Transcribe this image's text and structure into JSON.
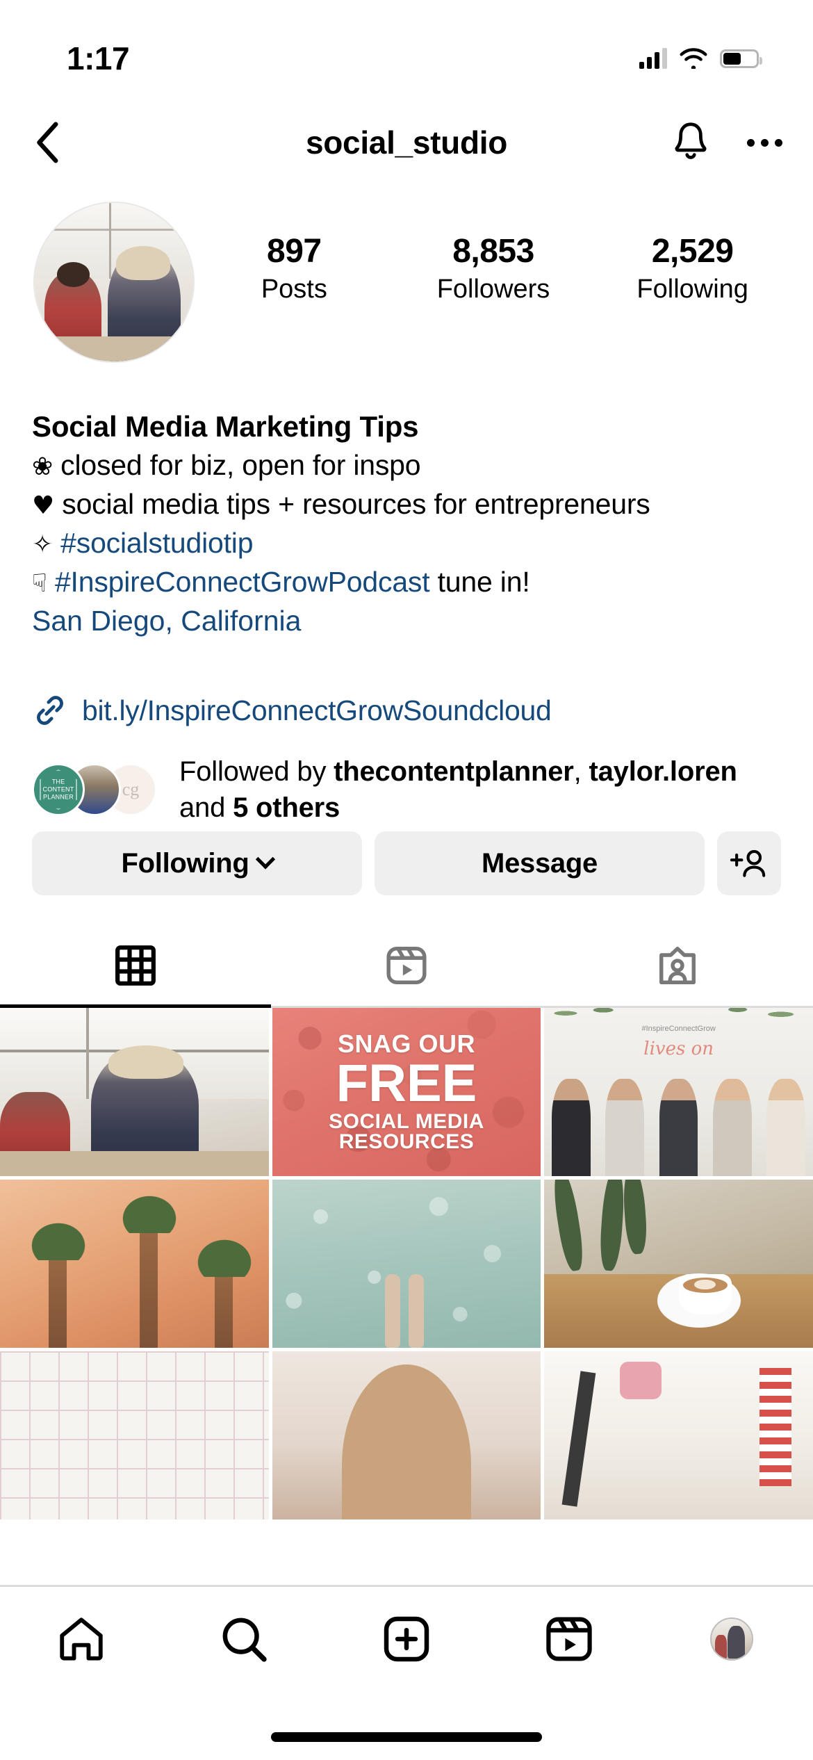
{
  "status_bar": {
    "time": "1:17",
    "signal_icon": "cellular-signal-icon",
    "wifi_icon": "wifi-icon",
    "battery_icon": "battery-icon",
    "battery_level_pct": 55
  },
  "nav": {
    "back_icon": "back-chevron-icon",
    "title": "social_studio",
    "bell_icon": "bell-icon",
    "more_icon": "more-options-icon"
  },
  "profile": {
    "avatar_name": "profile-avatar",
    "stats": [
      {
        "value": "897",
        "label": "Posts"
      },
      {
        "value": "8,853",
        "label": "Followers"
      },
      {
        "value": "2,529",
        "label": "Following"
      }
    ],
    "display_name": "Social Media Marketing Tips",
    "bio_lines": [
      {
        "emoji": "❀",
        "text": "closed for biz, open for inspo",
        "link": false
      },
      {
        "emoji": "♥",
        "text": "social media tips + resources for entrepreneurs",
        "link": false
      },
      {
        "emoji": "✧",
        "text": "#socialstudiotip",
        "link": true
      },
      {
        "emoji": "☟",
        "text": "#InspireConnectGrowPodcast",
        "trailing": " tune in!",
        "link": true
      }
    ],
    "location": "San Diego, California",
    "link_icon": "link-icon",
    "website": "bit.ly/InspireConnectGrowSoundcloud",
    "followed_by": {
      "prefix": "Followed by ",
      "name1": "thecontentplanner",
      "sep": ", ",
      "name2": "taylor.loren",
      "mid": " and ",
      "count": "5 others",
      "avatar1_label": "THE\nCONTENT\nPLANNER",
      "avatar1_line1": "THE",
      "avatar1_line2": "CONTENT",
      "avatar1_line3": "PLANNER",
      "avatar3_monogram": "cg"
    }
  },
  "actions": {
    "following_label": "Following",
    "following_chevron": "chevron-down-icon",
    "message_label": "Message",
    "add_person_icon": "add-person-icon"
  },
  "tabs": [
    {
      "name": "grid",
      "icon": "grid-icon",
      "active": true
    },
    {
      "name": "reels",
      "icon": "reels-icon",
      "active": false
    },
    {
      "name": "tagged",
      "icon": "tagged-icon",
      "active": false
    }
  ],
  "grid_posts": [
    {
      "id": 1,
      "alt": "woman in patterned jacket by window in cafe"
    },
    {
      "id": 2,
      "alt": "SNAG OUR FREE SOCIAL MEDIA RESOURCES",
      "text_lines": [
        "SNAG OUR",
        "FREE",
        "SOCIAL MEDIA",
        "RESOURCES"
      ]
    },
    {
      "id": 3,
      "alt": "group of women at event",
      "caption": "#InspireConnectGrow",
      "script": "lives on"
    },
    {
      "id": 4,
      "alt": "palm trees against peach sky"
    },
    {
      "id": 5,
      "alt": "feet in shallow turquoise water"
    },
    {
      "id": 6,
      "alt": "latte art coffee cup on wooden table"
    },
    {
      "id": 7,
      "alt": "pink grid paper flatlay"
    },
    {
      "id": 8,
      "alt": "portrait partial"
    },
    {
      "id": 9,
      "alt": "flatlay with strap and striped item"
    }
  ],
  "bottom_nav": [
    {
      "name": "home",
      "icon": "home-icon"
    },
    {
      "name": "search",
      "icon": "search-icon"
    },
    {
      "name": "create",
      "icon": "plus-square-icon"
    },
    {
      "name": "reels",
      "icon": "reels-icon"
    },
    {
      "name": "profile",
      "icon": "profile-avatar-icon"
    }
  ],
  "colors": {
    "link_blue": "#16497b",
    "button_bg": "#efefef",
    "divider": "#dbdbdb",
    "accent_coral": "#e0756c"
  }
}
